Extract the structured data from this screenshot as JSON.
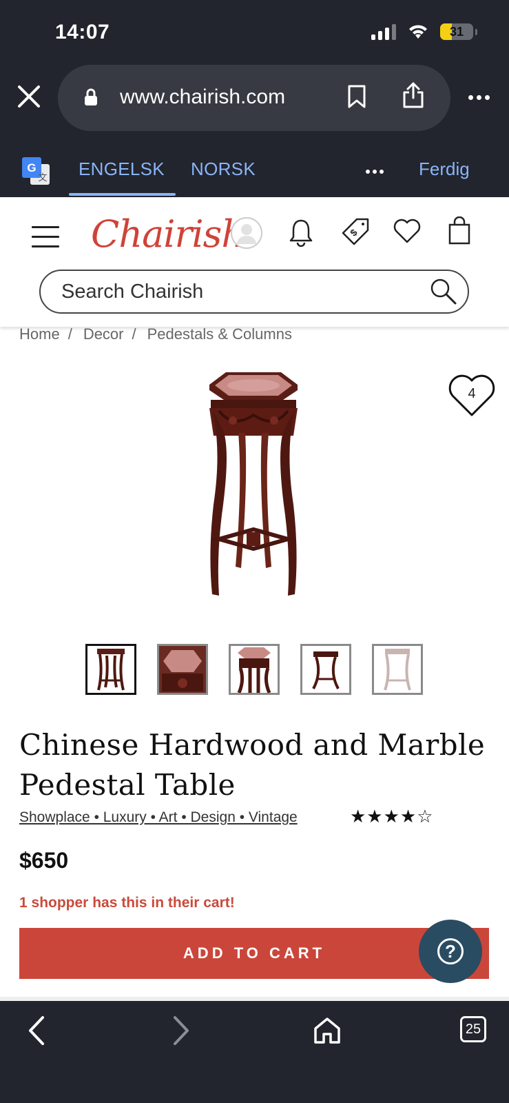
{
  "status_bar": {
    "time": "14:07",
    "battery_level": "31"
  },
  "browser": {
    "url": "www.chairish.com",
    "translate": {
      "source_lang": "ENGELSK",
      "target_lang": "NORSK",
      "done_label": "Ferdig"
    },
    "tab_count": "25"
  },
  "site": {
    "logo": "Chairish",
    "search_placeholder": "Search Chairish"
  },
  "breadcrumb": [
    "Home",
    "Decor",
    "Pedestals & Columns"
  ],
  "product": {
    "favorite_count": "4",
    "title": "Chinese Hardwood and Marble Pedestal Table",
    "tags": "Showplace • Luxury • Art • Design • Vintage",
    "rating_stars": "★★★★☆",
    "rating": 4,
    "price": "$650",
    "cart_alert": "1 shopper has this in their cart!",
    "add_to_cart_label": "ADD TO CART",
    "thumbnail_count": 5,
    "active_thumbnail": 0
  },
  "colors": {
    "brand_red": "#cf4338",
    "cta_red": "#cb463a",
    "help_blue": "#2a4c62",
    "chrome_bg": "#22252d",
    "link_blue": "#8ab4f8"
  }
}
